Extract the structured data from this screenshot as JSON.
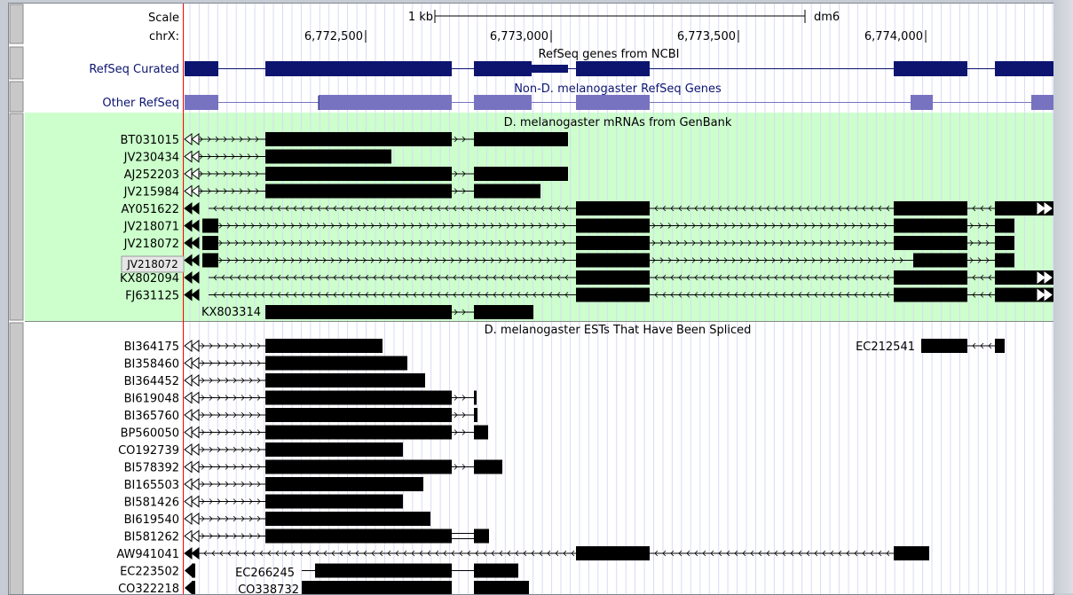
{
  "header": {
    "scale_label": "Scale",
    "chrom_label": "chrX:",
    "scale_bar": "1 kb",
    "assembly": "dm6",
    "positions": [
      "6,772,500",
      "6,773,000",
      "6,773,500",
      "6,774,000"
    ]
  },
  "tracks": {
    "refseq_title": "RefSeq genes from NCBI",
    "refseq_curated_label": "RefSeq Curated",
    "other_refseq_title": "Non-D. melanogaster RefSeq Genes",
    "other_refseq_label": "Other RefSeq",
    "mrna_title": "D. melanogaster mRNAs from GenBank",
    "est_title": "D. melanogaster ESTs That Have Been Spliced"
  },
  "mrna_rows": [
    "BT031015",
    "JV230434",
    "AJ252203",
    "JV215984",
    "AY051622",
    "JV218071",
    "JV218072",
    "JV218073",
    "KX802094",
    "FJ631125"
  ],
  "mrna_extra_label": "KX803314",
  "tooltip": "JV218072",
  "est_rows": [
    "BI364175",
    "BI358460",
    "BI364452",
    "BI619048",
    "BI365760",
    "BP560050",
    "CO192739",
    "BI578392",
    "BI165503",
    "BI581426",
    "BI619540",
    "BI581262",
    "AW941041",
    "EC223502",
    "CO322218"
  ],
  "est_extra_labels": [
    "EC212541",
    "EC266245",
    "CO338732"
  ],
  "colors": {
    "navy": "#0c1470",
    "lavender": "#7773c0",
    "mrna_bg": "#ccffcc",
    "highlight_line": "#ff0000",
    "grid": "#d8dbf5"
  }
}
